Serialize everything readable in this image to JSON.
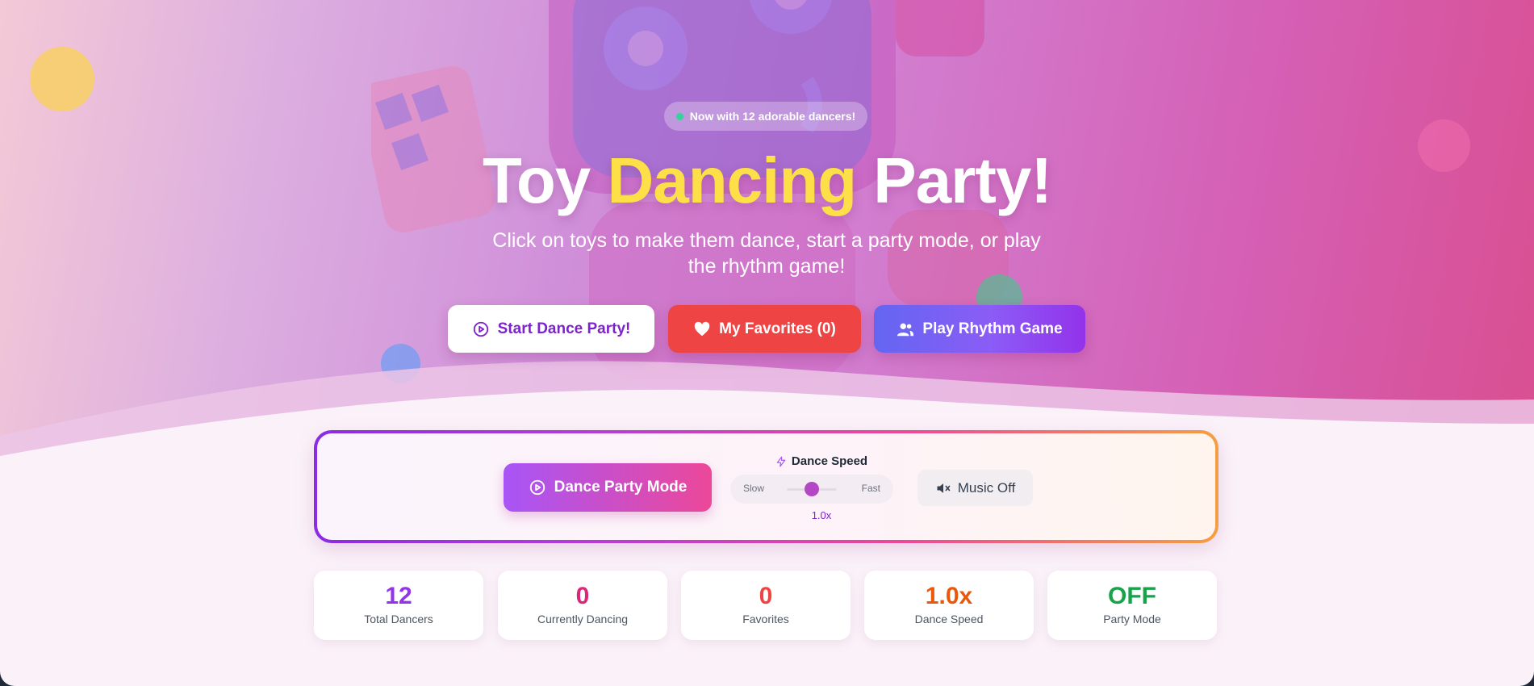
{
  "hero": {
    "badge": "Now with 12 adorable dancers!",
    "title_part1": "Toy",
    "title_highlight": "Dancing",
    "title_part2": "Party!",
    "subtitle": "Click on toys to make them dance, start a party mode, or play the rhythm game!",
    "buttons": {
      "start": "Start Dance Party!",
      "favorites": "My Favorites (0)",
      "rhythm": "Play Rhythm Game"
    }
  },
  "controls": {
    "dance_party_mode": "Dance Party Mode",
    "speed_label": "Dance Speed",
    "slow": "Slow",
    "fast": "Fast",
    "speed_value": "1.0x",
    "speed_position": 0.5,
    "music": "Music Off"
  },
  "stats": [
    {
      "value": "12",
      "label": "Total Dancers",
      "color": "#9333ea"
    },
    {
      "value": "0",
      "label": "Currently Dancing",
      "color": "#db2777"
    },
    {
      "value": "0",
      "label": "Favorites",
      "color": "#ef4444"
    },
    {
      "value": "1.0x",
      "label": "Dance Speed",
      "color": "#ea580c"
    },
    {
      "value": "OFF",
      "label": "Party Mode",
      "color": "#16a34a"
    }
  ],
  "colors": {
    "accent_purple": "#9333ea",
    "accent_pink": "#ec4899",
    "highlight_yellow": "#fde047",
    "favorites_red": "#ef4444"
  },
  "icons": {
    "badge": "status-dot-icon",
    "start": "play-circle-icon",
    "favorites": "heart-icon",
    "rhythm": "users-icon",
    "dance_party": "play-circle-icon",
    "speed": "lightning-icon",
    "music": "speaker-muted-icon"
  }
}
